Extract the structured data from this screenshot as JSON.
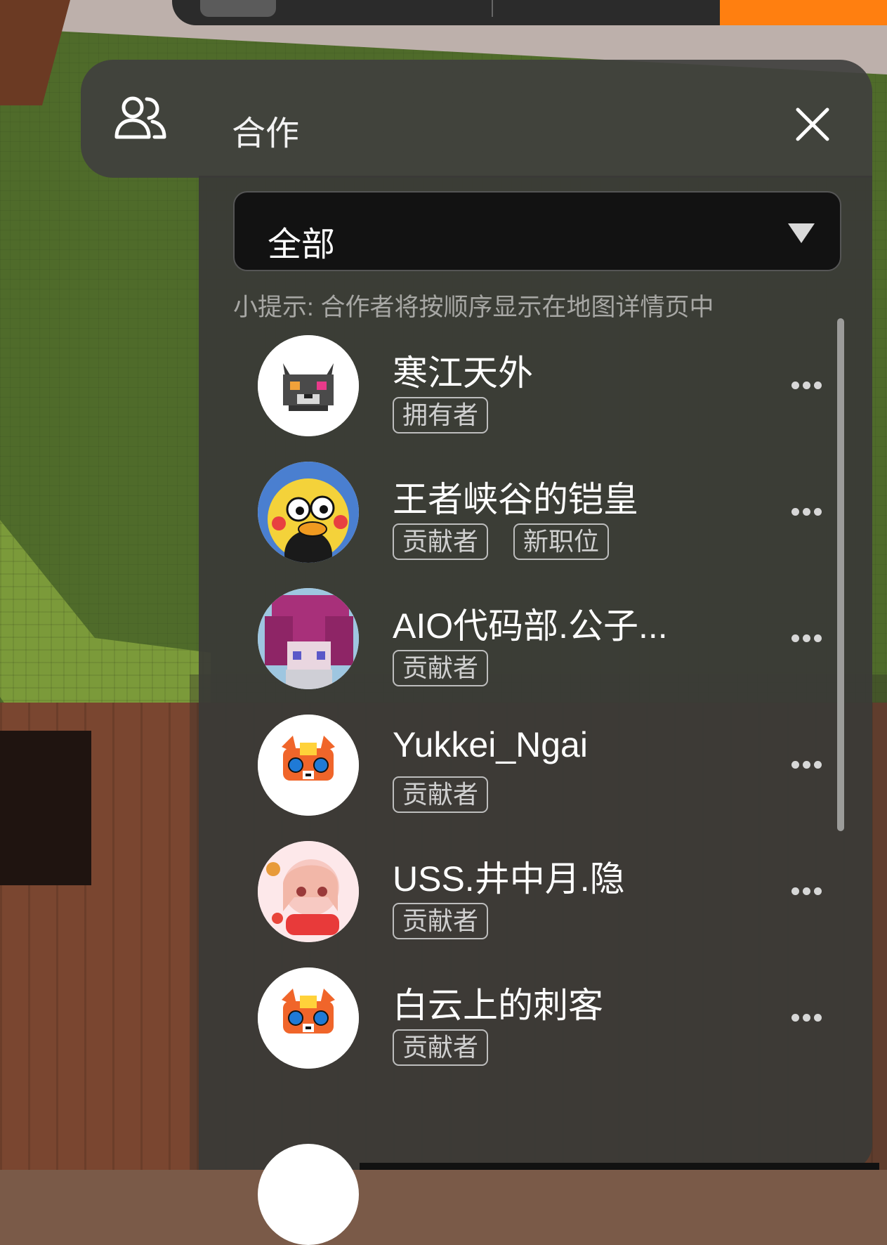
{
  "panel": {
    "title": "合作",
    "filter": {
      "selected": "全部"
    },
    "hint": "小提示: 合作者将按顺序显示在地图详情页中"
  },
  "collaborators": [
    {
      "name": "寒江天外",
      "roles": [
        "拥有者"
      ],
      "avatar": "wolf-avatar"
    },
    {
      "name": "王者峡谷的铠皇",
      "roles": [
        "贡献者",
        "新职位"
      ],
      "avatar": "yellow-duck-avatar"
    },
    {
      "name": "AIO代码部.公子...",
      "roles": [
        "贡献者"
      ],
      "avatar": "pink-hair-avatar"
    },
    {
      "name": "Yukkei_Ngai",
      "roles": [
        "贡献者"
      ],
      "avatar": "orange-cat-avatar"
    },
    {
      "name": "USS.井中月.隐",
      "roles": [
        "贡献者"
      ],
      "avatar": "anime-girl-avatar"
    },
    {
      "name": "白云上的刺客",
      "roles": [
        "贡献者"
      ],
      "avatar": "orange-cat-avatar"
    }
  ],
  "colors": {
    "accent": "#ff7f10",
    "panel": "#3a3a37",
    "dropdown": "#121212"
  }
}
